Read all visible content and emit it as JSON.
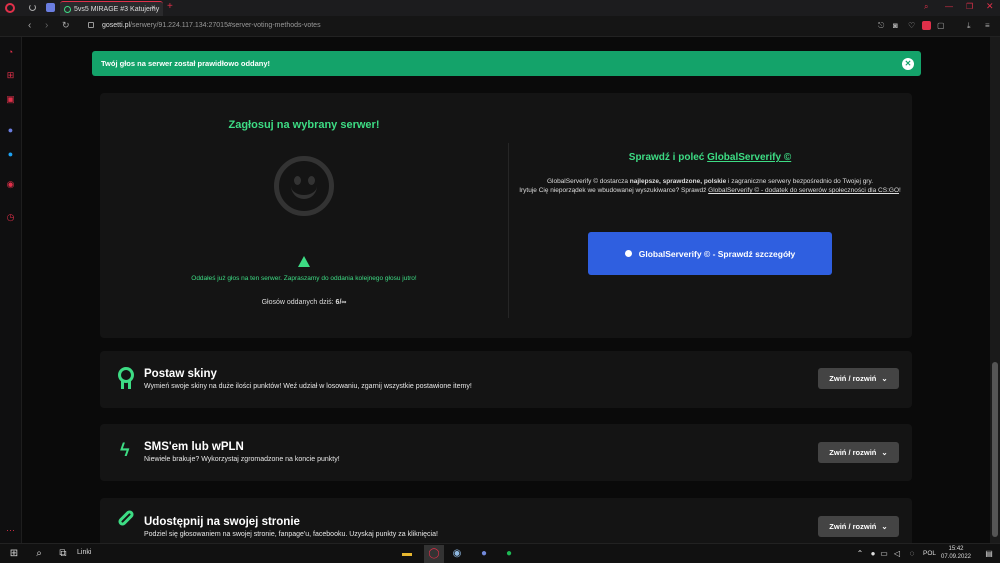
{
  "browser": {
    "tabs": [
      {
        "label": "5vs5 MIRAGE #3 Katujemy",
        "active": true
      }
    ],
    "url_domain": "gosetti.pl",
    "url_path": "/serwery/91.224.117.134:27015#server-voting-methods-votes"
  },
  "toast": {
    "message": "Twój głos na serwer został prawidłowo oddany!"
  },
  "vote": {
    "title": "Zagłosuj na wybrany serwer!",
    "notice": "Oddałeś już głos na ten serwer. Zapraszamy do oddania kolejnego głosu jutro!",
    "votes_label": "Głosów oddanych dziś:",
    "votes_value": "6/∞"
  },
  "promo": {
    "title_prefix": "Sprawdź i poleć",
    "title_link": "GlobalServerify ©",
    "desc_1": "GlobalServerify © dostarcza",
    "desc_bold": "najlepsze, sprawdzone, polskie",
    "desc_2": "i zagraniczne serwery bezpośrednio do Twojej gry.",
    "desc_3": "Irytuje Cię nieporządek we wbudowanej wyszukiwarce? Sprawdź",
    "desc_link": "GlobalServerify © - dodatek do serwerów społeczności dla CS:GO",
    "desc_end": "!",
    "button": "GlobalServerify © - Sprawdź szczegóły"
  },
  "sections": [
    {
      "title": "Postaw skiny",
      "desc": "Wymień swoje skiny na duże ilości punktów! Weź udział w losowaniu, zgarnij wszystkie postawione itemy!",
      "toggle": "Zwiń / rozwiń",
      "icon": "award-ribbon-icon"
    },
    {
      "title": "SMS'em lub wPLN",
      "desc": "Niewiele brakuje? Wykorzystaj zgromadzone na koncie punkty!",
      "toggle": "Zwiń / rozwiń",
      "icon": "lightning-icon"
    },
    {
      "title": "Udostępnij na swojej stronie",
      "desc": "Podziel się głosowaniem na swojej stronie, fanpage'u, facebooku. Uzyskaj punkty za kliknięcia!",
      "toggle": "Zwiń / rozwiń",
      "icon": "link-icon"
    }
  ],
  "taskbar": {
    "links_label": "Linki",
    "lang": "POL",
    "time": "15:42",
    "date": "07.09.2022"
  },
  "colors": {
    "accent_green": "#14a36a",
    "vote_green": "#3ddc84",
    "blue_button": "#2f5fe0",
    "opera_red": "#e0304a"
  }
}
